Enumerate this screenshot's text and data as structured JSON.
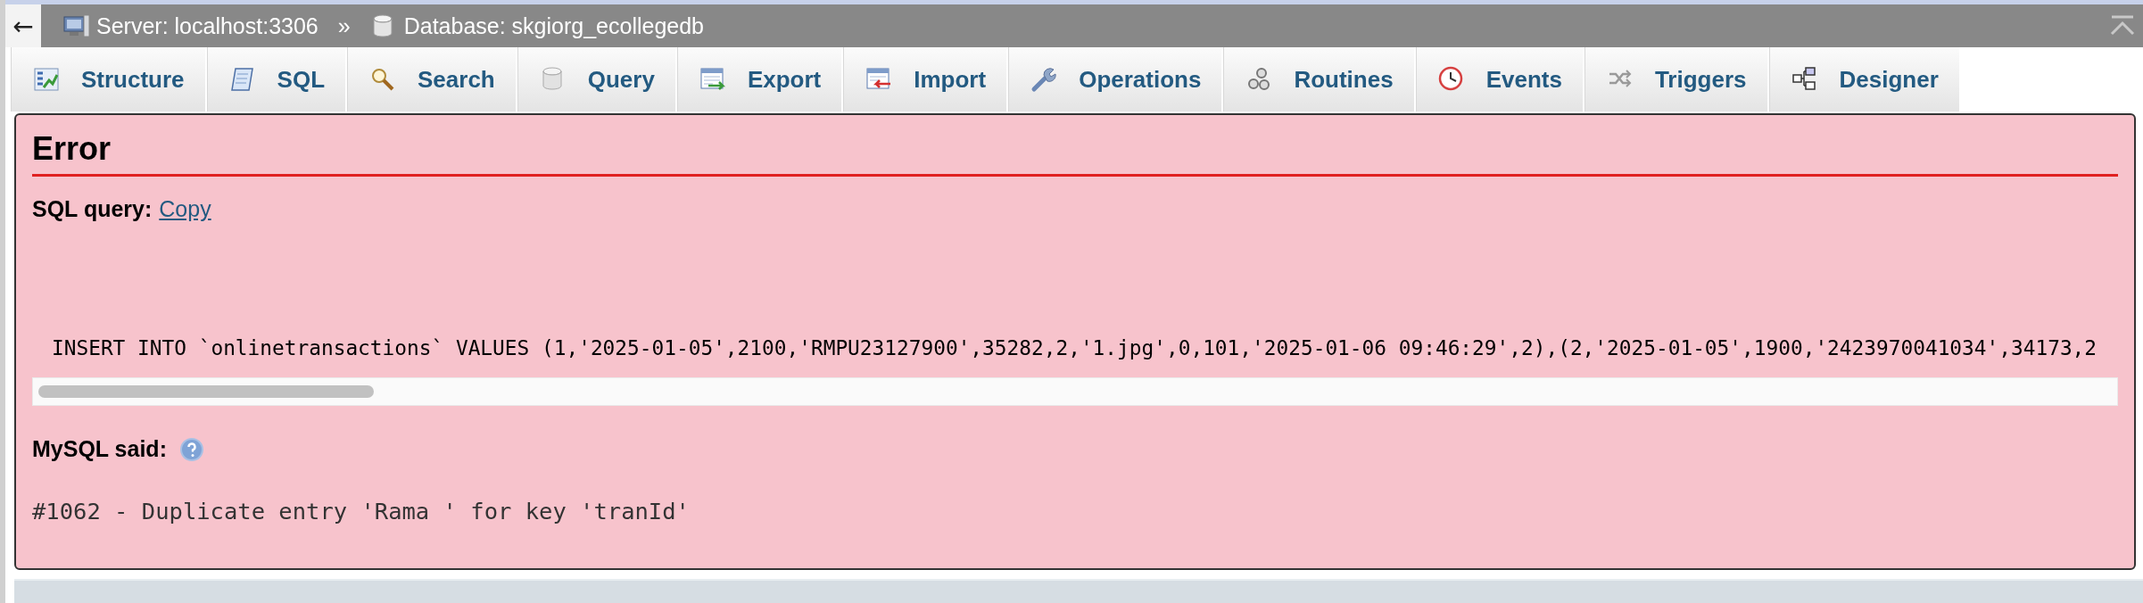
{
  "back_button": {
    "label": "←"
  },
  "breadcrumb": [
    {
      "kind": "server",
      "label": "Server: localhost:3306"
    },
    {
      "kind": "separator",
      "label": "»"
    },
    {
      "kind": "database",
      "label": "Database: skgiorg_ecollegedb"
    }
  ],
  "tabs": [
    {
      "label": "Structure",
      "selected": false
    },
    {
      "label": "SQL",
      "selected": false
    },
    {
      "label": "Search",
      "selected": false
    },
    {
      "label": "Query",
      "selected": false
    },
    {
      "label": "Export",
      "selected": false
    },
    {
      "label": "Import",
      "selected": false
    },
    {
      "label": "Operations",
      "selected": false
    },
    {
      "label": "Routines",
      "selected": false
    },
    {
      "label": "Events",
      "selected": false
    },
    {
      "label": "Triggers",
      "selected": false
    },
    {
      "label": "Designer",
      "selected": false
    }
  ],
  "error": {
    "title": "Error",
    "query_label": "SQL query:",
    "copy_link": "Copy",
    "query": "INSERT INTO `onlinetransactions` VALUES (1,'2025-01-05',2100,'RMPU23127900',35282,2,'1.jpg',0,101,'2025-01-06 09:46:29',2),(2,'2025-01-05',1900,'2423970041034',34173,2",
    "said_label": "MySQL said:",
    "message": "#1062 - Duplicate entry 'Rama ' for key 'tranId'"
  }
}
